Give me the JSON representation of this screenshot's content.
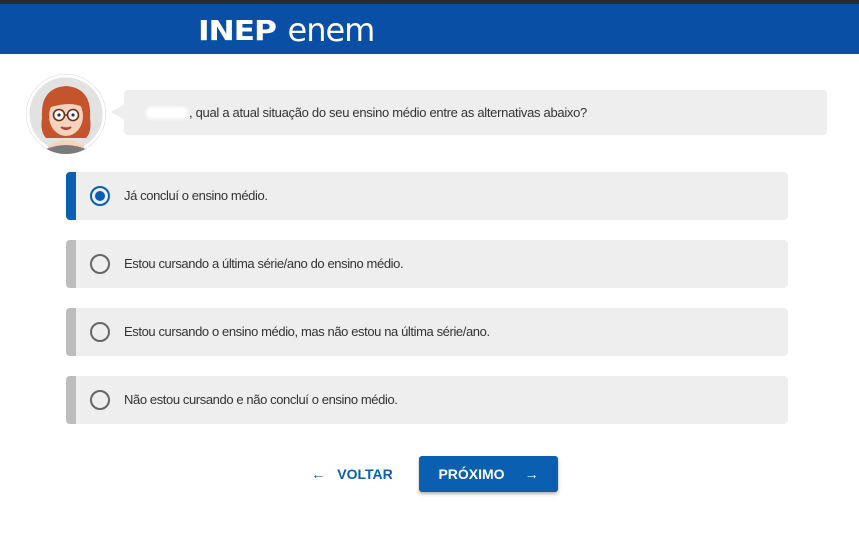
{
  "header": {
    "logo_inep": "INEP",
    "logo_enem": "enem",
    "background_color": "#0a4fa6"
  },
  "chat": {
    "avatar_icon": "cartoon-woman-avatar",
    "question": ", qual a atual situação do seu ensino médio entre as alternativas abaixo?"
  },
  "options": [
    {
      "label": "Já concluí o ensino médio.",
      "selected": true
    },
    {
      "label": "Estou cursando a última série/ano do ensino médio.",
      "selected": false
    },
    {
      "label": "Estou cursando o ensino médio, mas não estou na última série/ano.",
      "selected": false
    },
    {
      "label": "Não estou cursando e não concluí o ensino médio.",
      "selected": false
    }
  ],
  "navigation": {
    "back_label": "VOLTAR",
    "back_icon": "arrow-left-icon",
    "next_label": "PRÓXIMO",
    "next_icon": "arrow-right-icon",
    "accent_color": "#0a5fb0"
  }
}
